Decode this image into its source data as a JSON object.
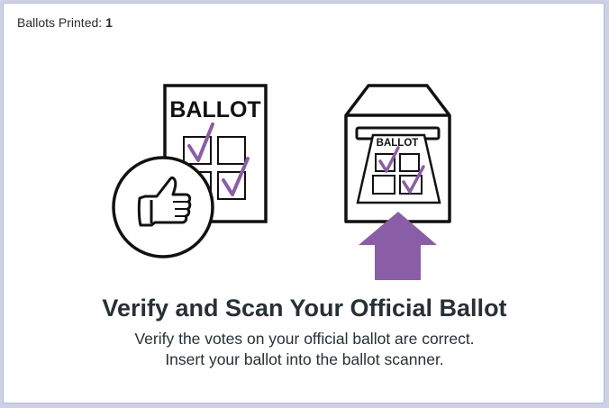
{
  "status": {
    "label": "Ballots Printed:",
    "count": "1"
  },
  "illustration": {
    "ballot_word": "BALLOT",
    "scanner_ballot_word": "BALLOT",
    "accent_color": "#8a5ea6",
    "icons": [
      "ballot-icon",
      "thumbs-up-icon",
      "ballot-scanner-icon",
      "arrow-up-icon"
    ]
  },
  "heading": "Verify and Scan Your Official Ballot",
  "instructions": {
    "line1": "Verify the votes on your official ballot are correct.",
    "line2": "Insert your ballot into the ballot scanner."
  }
}
